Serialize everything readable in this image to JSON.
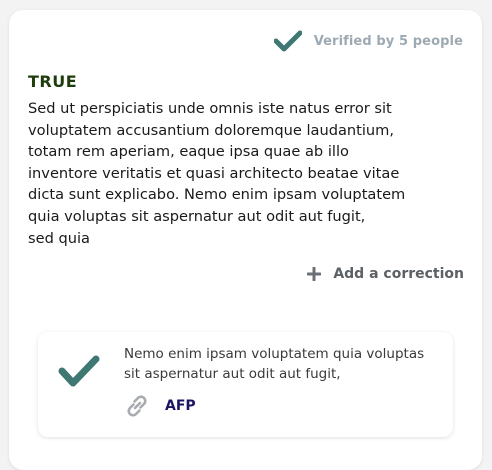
{
  "colors": {
    "check": "#3f7772",
    "verdict": "#1f3d0c",
    "muted": "#9eaab3",
    "link": "#1b1463"
  },
  "header": {
    "verified_icon": "checkmark-icon",
    "verified_text": "Verified by 5 people"
  },
  "claim": {
    "verdict": "TRUE",
    "text": "Sed ut perspiciatis unde omnis iste natus error sit\nvoluptatem accusantium doloremque laudantium,\ntotam rem aperiam, eaque ipsa quae ab illo\ninventore veritatis et quasi architecto beatae vitae\ndicta sunt explicabo. Nemo enim ipsam voluptatem\nquia voluptas sit aspernatur aut odit aut fugit,\nsed quia"
  },
  "actions": {
    "add_correction_icon": "plus-icon",
    "add_correction_label": "Add a correction"
  },
  "source": {
    "verdict_icon": "checkmark-icon",
    "text": "Nemo enim ipsam voluptatem quia voluptas\nsit aspernatur aut odit aut fugit,",
    "link_icon": "link-icon",
    "link_label": "AFP"
  }
}
